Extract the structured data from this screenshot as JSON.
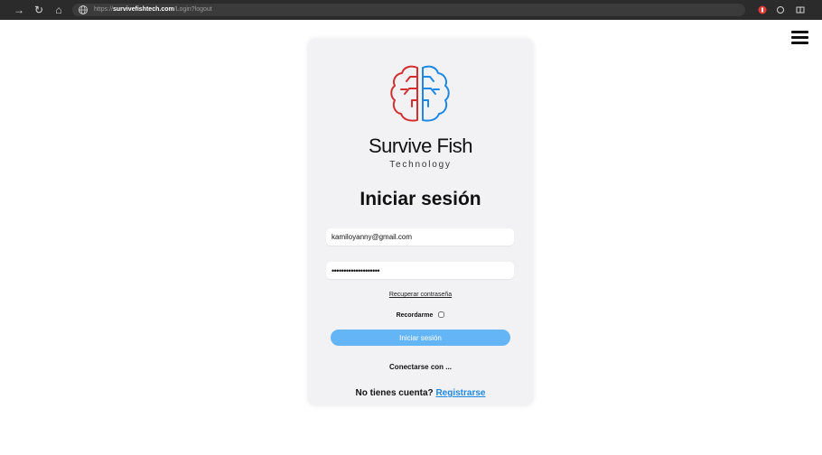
{
  "browser": {
    "url_scheme": "https://",
    "url_domain": "survivefishtech.com",
    "url_path": "/Login?logout"
  },
  "login": {
    "brand_name": "Survive Fish",
    "brand_tagline": "Technology",
    "title": "Iniciar sesión",
    "email_value": "kamiloyanny@gmail.com",
    "password_value": "password1234567890ab",
    "recover_link": "Recuperar contraseña",
    "remember_label": "Recordarme",
    "submit_label": "Iniciar sesión",
    "connect_with": "Conectarse con ...",
    "no_account": "No tienes cuenta?",
    "register_link": "Registrarse"
  },
  "icons": {
    "logo_left_hemisphere": "brain-left-icon",
    "logo_right_hemisphere": "brain-right-icon",
    "menu": "hamburger-menu-icon"
  },
  "colors": {
    "logo_left": "#d32f2f",
    "logo_right": "#1e88e5",
    "submit_bg": "#64b5f6",
    "link": "#1e88e5",
    "card_bg": "#f2f2f4"
  }
}
